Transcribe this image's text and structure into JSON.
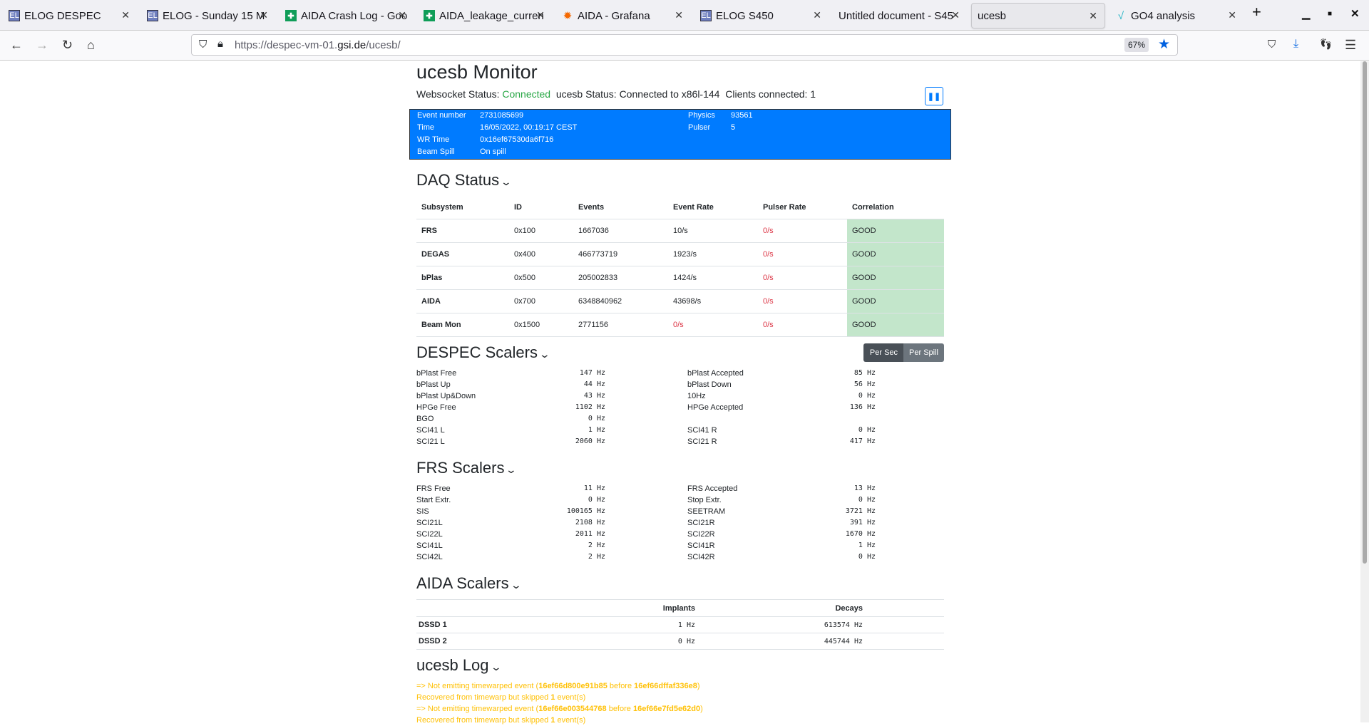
{
  "browser": {
    "tabs": [
      {
        "title": "ELOG DESPEC",
        "icon": "elog"
      },
      {
        "title": "ELOG - Sunday 15 M",
        "icon": "elog"
      },
      {
        "title": "AIDA Crash Log - Goo",
        "icon": "sheet"
      },
      {
        "title": "AIDA_leakage_curren",
        "icon": "sheet"
      },
      {
        "title": "AIDA - Grafana",
        "icon": "grafana"
      },
      {
        "title": "ELOG S450",
        "icon": "elog"
      },
      {
        "title": "Untitled document - S45",
        "icon": "none"
      },
      {
        "title": "ucesb",
        "icon": "none",
        "active": true
      },
      {
        "title": "GO4 analysis",
        "icon": "go4"
      }
    ],
    "url_prefix": "https://despec-vm-01.",
    "url_domain": "gsi.de",
    "url_path": "/ucesb/",
    "zoom": "67%"
  },
  "page": {
    "title": "ucesb Monitor",
    "ws_label": "Websocket Status:",
    "ws_value": "Connected",
    "ucesb_status": "ucesb Status: Connected to x86l-144",
    "clients": "Clients connected: 1",
    "info": {
      "event_number_label": "Event number",
      "event_number": "2731085699",
      "time_label": "Time",
      "time": "16/05/2022, 00:19:17 CEST",
      "wr_label": "WR Time",
      "wr": "0x16ef67530da6f716",
      "spill_label": "Beam Spill",
      "spill": "On spill",
      "physics_label": "Physics",
      "physics": "93561",
      "pulser_label": "Pulser",
      "pulser": "5"
    },
    "daq": {
      "heading": "DAQ Status",
      "columns": [
        "Subsystem",
        "ID",
        "Events",
        "Event Rate",
        "Pulser Rate",
        "Correlation"
      ],
      "rows": [
        [
          "FRS",
          "0x100",
          "1667036",
          "10/s",
          "0/s",
          "GOOD"
        ],
        [
          "DEGAS",
          "0x400",
          "466773719",
          "1923/s",
          "0/s",
          "GOOD"
        ],
        [
          "bPlas",
          "0x500",
          "205002833",
          "1424/s",
          "0/s",
          "GOOD"
        ],
        [
          "AIDA",
          "0x700",
          "6348840962",
          "43698/s",
          "0/s",
          "GOOD"
        ],
        [
          "Beam Mon",
          "0x1500",
          "2771156",
          "0/s",
          "0/s",
          "GOOD"
        ]
      ]
    },
    "despec": {
      "heading": "DESPEC Scalers",
      "per_sec": "Per Sec",
      "per_spill": "Per Spill",
      "left": [
        [
          "bPlast Free",
          "147 Hz"
        ],
        [
          "bPlast Up",
          "44 Hz"
        ],
        [
          "bPlast Up&Down",
          "43 Hz"
        ],
        [
          "HPGe Free",
          "1102 Hz"
        ],
        [
          "BGO",
          "0 Hz"
        ],
        [
          "SCI41 L",
          "1 Hz"
        ],
        [
          "SCI21 L",
          "2060 Hz"
        ]
      ],
      "right": [
        [
          "bPlast Accepted",
          "85 Hz"
        ],
        [
          "bPlast Down",
          "56 Hz"
        ],
        [
          "10Hz",
          "0 Hz"
        ],
        [
          "HPGe Accepted",
          "136 Hz"
        ],
        [
          "",
          ""
        ],
        [
          "SCI41 R",
          "0 Hz"
        ],
        [
          "SCI21 R",
          "417 Hz"
        ]
      ]
    },
    "frs": {
      "heading": "FRS Scalers",
      "left": [
        [
          "FRS Free",
          "11 Hz"
        ],
        [
          "Start Extr.",
          "0 Hz"
        ],
        [
          "SIS",
          "100165 Hz"
        ],
        [
          "SCI21L",
          "2108 Hz"
        ],
        [
          "SCI22L",
          "2011 Hz"
        ],
        [
          "SCI41L",
          "2 Hz"
        ],
        [
          "SCI42L",
          "2 Hz"
        ]
      ],
      "right": [
        [
          "FRS Accepted",
          "13 Hz"
        ],
        [
          "Stop Extr.",
          "0 Hz"
        ],
        [
          "SEETRAM",
          "3721 Hz"
        ],
        [
          "SCI21R",
          "391 Hz"
        ],
        [
          "SCI22R",
          "1670 Hz"
        ],
        [
          "SCI41R",
          "1 Hz"
        ],
        [
          "SCI42R",
          "0 Hz"
        ]
      ]
    },
    "aida": {
      "heading": "AIDA Scalers",
      "col_implants": "Implants",
      "col_decays": "Decays",
      "rows": [
        [
          "DSSD 1",
          "1 Hz",
          "613574 Hz"
        ],
        [
          "DSSD 2",
          "0 Hz",
          "445744 Hz"
        ]
      ]
    },
    "log": {
      "heading": "ucesb Log",
      "lines": [
        {
          "pre": "=> Not emitting timewarped event (",
          "a": "16ef66d800e91b85",
          "mid": " before ",
          "b": "16ef66dffaf336e8",
          "post": ")"
        },
        {
          "pre": "Recovered from timewarp but skipped ",
          "a": "1",
          "mid": " event(s)",
          "b": "",
          "post": ""
        },
        {
          "pre": "=> Not emitting timewarped event (",
          "a": "16ef66e003544768",
          "mid": " before ",
          "b": "16ef66e7fd5e62d0",
          "post": ")"
        },
        {
          "pre": "Recovered from timewarp but skipped ",
          "a": "1",
          "mid": " event(s)",
          "b": "",
          "post": ""
        }
      ]
    }
  }
}
